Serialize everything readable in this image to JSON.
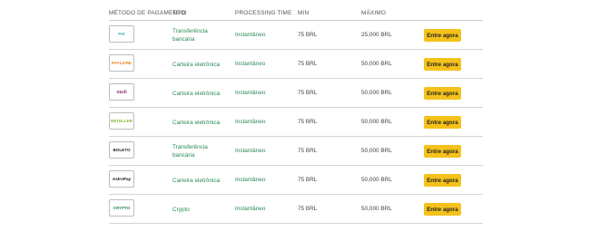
{
  "headers": {
    "method": "MÉTODO DE PAGAMENTO",
    "type": "TIPO",
    "processing_time": "PROCESSING TIME",
    "min": "MIN",
    "max": "MÁXIMO"
  },
  "rows": [
    {
      "logo_text": "PIX",
      "logo_color": "#32bcad",
      "logo_icon": "pix-icon",
      "type": "Transferência bancária",
      "processing_time": "Instantâneo",
      "min": "75 BRL",
      "max": "25,000 BRL",
      "action": "Entre agora"
    },
    {
      "logo_text": "PAYLIVRE",
      "logo_color": "#e8851e",
      "logo_icon": "paylivre-icon",
      "type": "Carteira eletrônica",
      "processing_time": "Instantâneo",
      "min": "75 BRL",
      "max": "50,000 BRL",
      "action": "Entre agora"
    },
    {
      "logo_text": "Skrill",
      "logo_color": "#862165",
      "logo_icon": "skrill-icon",
      "type": "Carteira eletrônica",
      "processing_time": "Instantâneo",
      "min": "75 BRL",
      "max": "50,000 BRL",
      "action": "Entre agora"
    },
    {
      "logo_text": "NETELLER",
      "logo_color": "#83ba3b",
      "logo_icon": "neteller-icon",
      "type": "Carteira eletrônica",
      "processing_time": "Instantâneo",
      "min": "75 BRL",
      "max": "50,000 BRL",
      "action": "Entre agora"
    },
    {
      "logo_text": "BOLETO",
      "logo_color": "#222222",
      "logo_icon": "boleto-icon",
      "type": "Transferência bancária",
      "processing_time": "Instantâneo",
      "min": "75 BRL",
      "max": "50,000 BRL",
      "action": "Entre agora"
    },
    {
      "logo_text": "AstroPay",
      "logo_color": "#111111",
      "logo_icon": "astropay-icon",
      "type": "Carteira eletrônica",
      "processing_time": "Instantâneo",
      "min": "75 BRL",
      "max": "50,000 BRL",
      "action": "Entre agora"
    },
    {
      "logo_text": "CRYPTO",
      "logo_color": "#2b8a57",
      "logo_icon": "crypto-icon",
      "type": "Crypto",
      "processing_time": "Instantâneo",
      "min": "75 BRL",
      "max": "50,000 BRL",
      "action": "Entre agora"
    }
  ]
}
